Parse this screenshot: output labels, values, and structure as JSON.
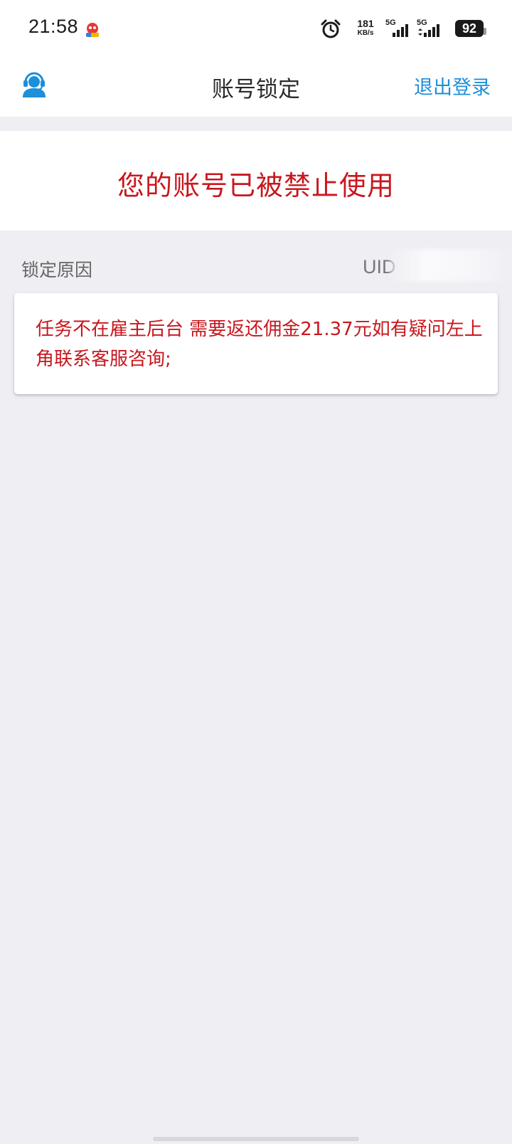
{
  "status_bar": {
    "time": "21:58",
    "network_speed": "181",
    "network_speed_unit": "KB/s",
    "signal_1_tag": "5G",
    "signal_2_tag": "5G",
    "battery": "92"
  },
  "header": {
    "title": "账号锁定",
    "logout_label": "退出登录",
    "left_icon": "customer-service-icon"
  },
  "banner": {
    "message": "您的账号已被禁止使用"
  },
  "reason": {
    "label": "锁定原因",
    "uid_label": "UID",
    "text": "任务不在雇主后台 需要返还佣金21.37元如有疑问左上角联系客服咨询;"
  },
  "colors": {
    "accent_blue": "#1e8fd9",
    "alert_red": "#c8171e",
    "background": "#eeeef3"
  }
}
